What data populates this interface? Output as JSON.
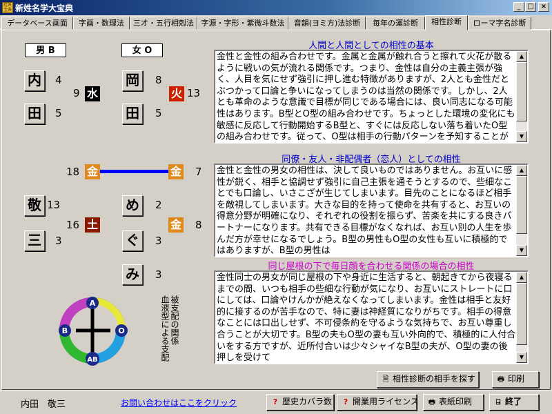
{
  "window": {
    "title": "新姓名学大宝典",
    "icon_text": "姓名宝典",
    "btn_min": "_",
    "btn_max": "□",
    "btn_close": "×"
  },
  "tabs": [
    "データベース画面",
    "字画・数理法",
    "三才・五行相剋法",
    "字源・字形・紫微斗数法",
    "音韻(ヨミ方)法診断",
    "毎年の運診断",
    "相性診断",
    "ローマ字名診断"
  ],
  "active_tab": 6,
  "male": {
    "label": "男 B",
    "chars": [
      {
        "ch": "内",
        "strokes": "4"
      },
      {
        "ch": "田",
        "strokes": "5"
      },
      {
        "ch": "敬",
        "strokes": "13"
      },
      {
        "ch": "三",
        "strokes": "3"
      }
    ],
    "upper_total": "9",
    "upper_element": "水",
    "lower_total": "16",
    "lower_element": "土",
    "connector_total": "18",
    "connector_element": "金"
  },
  "female": {
    "label": "女 O",
    "chars": [
      {
        "ch": "岡",
        "strokes": "8"
      },
      {
        "ch": "田",
        "strokes": "5"
      },
      {
        "ch": "め",
        "strokes": "2"
      },
      {
        "ch": "ぐ",
        "strokes": "3"
      },
      {
        "ch": "み",
        "strokes": "3"
      }
    ],
    "upper_total": "13",
    "upper_element": "火",
    "connector_total": "7",
    "connector_element": "金",
    "lower_total": "8",
    "lower_element": "金"
  },
  "colors": {
    "water": "#000000",
    "fire": "#cc2200",
    "metal": "#e08a1e",
    "earth": "#8b1a00",
    "link": "#0000ff",
    "title_blue": "#0000cc",
    "title_magenta": "#cc00cc"
  },
  "blood_chart": {
    "a": "A",
    "b": "B",
    "o": "O",
    "ab": "AB"
  },
  "blood_caption_1": "血液型による支配",
  "blood_caption_2": "被支配の関係",
  "sections": [
    {
      "title": "人間と人間としての相性の基本",
      "text": "金性と金性の組み合わせです。金属と金属が触れ合うと擦れて火花が散るように戦いの気が流れる関係です。つまり、金性は自分の主義主張が強く、人目を気にせず強引に押し進む特徴がありますが、2人とも金性だとぶつかって口論と争いになってしまうのは当然の関係です。しかし、2人とも革命のような意識で目標が同じである場合には、良い同志になる可能性はあります。B型とO型の組み合わせです。ちょっとした環境の変化にも敏感に反応して行動開始するB型と、すぐには反応しない落ち着いたO型の組み合わせです。従って、O型は相手の行動パターンを予知することができ、心"
    },
    {
      "title": "同僚・友人・非配偶者（恋人）としての相性",
      "text": "金性と金性の男女の相性は、決して良いものではありません。お互いに感性が鋭く、相手と協調せず強引に自己主張を通そうとするので、些細なことでも口論し、いさこざが生じてしまいます。目先のことになるほど相手を敵視してしまいます。大きな目的を持って使命を共有すると、お互いの得意分野が明確になり、それぞれの役割を振らず、苦楽を共にする良きパートナーになります。共有できる目標がなくなれば、お互い別の人生を歩んだ方が幸せになるでしょう。B型の男性もO型の女性も互いに積極的ではありますが、B型の男性は"
    },
    {
      "title": "同じ屋根の下で毎日顔を合わせる関係の場合の相性",
      "text": "金性同士の男女が同じ屋根の下や身近に生活すると、朝起きてから夜寝るまでの間、いつも相手の些細な行動が気になり、お互いにストレートに口にしては、口論やけんかが絶えなくなってしまいます。金性は相手と友好的に接するのが苦手なので、特に妻は神経質になりがちです。相手の得意なことには口出しせず、不可侵条約を守るような気持ちで、お互い尊重し合うことが大切です。B型の夫もO型の妻も互い外向的で、積極的に人付合いをする方ですが、近所付合いは少々シャイなB型の夫が、O型の妻の後押しを受けて"
    }
  ],
  "buttons": {
    "search": "相性診断の相手を探す",
    "print": "印刷",
    "history": "歴史カバラ数",
    "license": "開業用ライセンス",
    "cover_print": "表紙印刷",
    "exit": "終了"
  },
  "status": {
    "name": "内田　敬三",
    "contact_link": "お問い合わせはここをクリック"
  }
}
